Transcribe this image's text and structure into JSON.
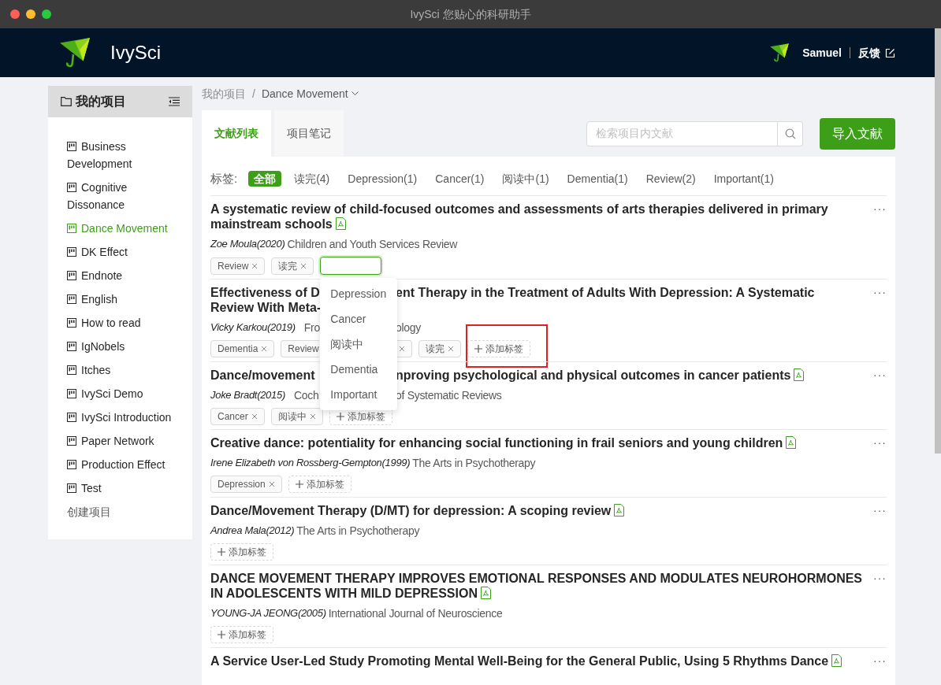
{
  "window": {
    "title": "IvySci 您贴心的科研助手"
  },
  "header": {
    "brand": "IvySci",
    "user": "Samuel",
    "feedback": "反馈"
  },
  "sidebar": {
    "title": "我的项目",
    "items": [
      {
        "label": "Business Development",
        "selected": false
      },
      {
        "label": "Cognitive Dissonance",
        "selected": false
      },
      {
        "label": "Dance Movement",
        "selected": true
      },
      {
        "label": "DK Effect",
        "selected": false
      },
      {
        "label": "Endnote",
        "selected": false
      },
      {
        "label": "English",
        "selected": false
      },
      {
        "label": "How to read",
        "selected": false
      },
      {
        "label": "IgNobels",
        "selected": false
      },
      {
        "label": "Itches",
        "selected": false
      },
      {
        "label": "IvySci Demo",
        "selected": false
      },
      {
        "label": "IvySci Introduction",
        "selected": false
      },
      {
        "label": "Paper Network",
        "selected": false
      },
      {
        "label": "Production Effect",
        "selected": false
      },
      {
        "label": "Test",
        "selected": false
      }
    ],
    "create": "创建项目"
  },
  "breadcrumb": {
    "root": "我的项目",
    "separator": "/",
    "current": "Dance Movement"
  },
  "tabs": [
    {
      "label": "文献列表",
      "selected": true
    },
    {
      "label": "项目笔记",
      "selected": false
    }
  ],
  "search": {
    "placeholder": "检索项目内文献"
  },
  "import_button": "导入文献",
  "filter": {
    "label": "标签:",
    "items": [
      {
        "label": "全部",
        "selected": true
      },
      {
        "label": "读完(4)",
        "selected": false
      },
      {
        "label": "Depression(1)",
        "selected": false
      },
      {
        "label": "Cancer(1)",
        "selected": false
      },
      {
        "label": "阅读中(1)",
        "selected": false
      },
      {
        "label": "Dementia(1)",
        "selected": false
      },
      {
        "label": "Review(2)",
        "selected": false
      },
      {
        "label": "Important(1)",
        "selected": false
      }
    ]
  },
  "dropdown": {
    "options": [
      "Depression",
      "Cancer",
      "阅读中",
      "Dementia",
      "Important"
    ]
  },
  "articles": [
    {
      "title_lines": [
        [
          "A systematic review of child-focused outcomes and assessments of arts therapies delivered in primary"
        ],
        [
          "mainstream schools"
        ]
      ],
      "pdf": true,
      "author": "Zoe Moula(2020)",
      "journal_parts": [
        "Children and Youth Services Review"
      ],
      "tag_parts": [
        [
          {
            "kind": "tag",
            "label": "Review",
            "close": true
          },
          {
            "kind": "tag",
            "label": "读完",
            "close": true
          },
          {
            "kind": "input",
            "focused": true
          }
        ]
      ],
      "more": "···"
    },
    {
      "title_lines": [
        [
          "Effectiveness of D",
          "ent Therapy in the Treatment of Adults With Depression: A Systematic"
        ],
        [
          "Review With Meta-"
        ]
      ],
      "pdf": false,
      "author": "Vicky Karkou(2019)",
      "journal_parts": [
        "Fro",
        "ology"
      ],
      "tag_parts": [
        [
          {
            "kind": "tag",
            "label": "Dementia",
            "close": true
          },
          {
            "kind": "tag",
            "label": "Review",
            "close": false
          }
        ],
        [
          {
            "kind": "tag",
            "close": true
          },
          {
            "kind": "tag",
            "label": "读完",
            "close": true
          },
          {
            "kind": "add",
            "label": "添加标签",
            "highlighted": true
          }
        ]
      ],
      "more": "···"
    },
    {
      "title_lines": [
        [
          "Dance/movement",
          "nproving psychological and physical outcomes in cancer patients"
        ]
      ],
      "pdf": true,
      "author": "Joke Bradt(2015)",
      "journal_parts": [
        "Coch",
        "of Systematic Reviews"
      ],
      "tag_parts": [
        [
          {
            "kind": "tag",
            "label": "Cancer",
            "close": true
          },
          {
            "kind": "tag",
            "label": "阅读中",
            "close": true
          },
          {
            "kind": "add",
            "label": "添加标签",
            "highlighted": false
          }
        ]
      ],
      "more": "···"
    },
    {
      "title_lines": [
        [
          "Creative dance: potentiality for enhancing social functioning in frail seniors and young children"
        ]
      ],
      "pdf": true,
      "author": "Irene Elizabeth von Rossberg-Gempton(1999)",
      "journal_parts": [
        "The Arts in Psychotherapy"
      ],
      "tag_parts": [
        [
          {
            "kind": "tag",
            "label": "Depression",
            "close": true
          },
          {
            "kind": "add",
            "label": "添加标签",
            "highlighted": false
          }
        ]
      ],
      "more": "···"
    },
    {
      "title_lines": [
        [
          "Dance/Movement Therapy (D/MT) for depression: A scoping review"
        ]
      ],
      "pdf": true,
      "author": "Andrea Mala(2012)",
      "journal_parts": [
        "The Arts in Psychotherapy"
      ],
      "tag_parts": [
        [
          {
            "kind": "add",
            "label": "添加标签",
            "highlighted": false
          }
        ]
      ],
      "more": "···"
    },
    {
      "title_lines": [
        [
          "DANCE MOVEMENT THERAPY IMPROVES EMOTIONAL RESPONSES AND MODULATES NEUROHORMONES"
        ],
        [
          "IN ADOLESCENTS WITH MILD DEPRESSION"
        ]
      ],
      "pdf": true,
      "author": "YOUNG-JA JEONG(2005)",
      "journal_parts": [
        "International Journal of Neuroscience"
      ],
      "tag_parts": [
        [
          {
            "kind": "add",
            "label": "添加标签",
            "highlighted": false
          }
        ]
      ],
      "more": "···"
    },
    {
      "title_lines": [
        [
          "A Service User-Led Study Promoting Mental Well-Being for the General Public, Using 5 Rhythms Dance"
        ]
      ],
      "pdf": true,
      "more": "···"
    }
  ]
}
